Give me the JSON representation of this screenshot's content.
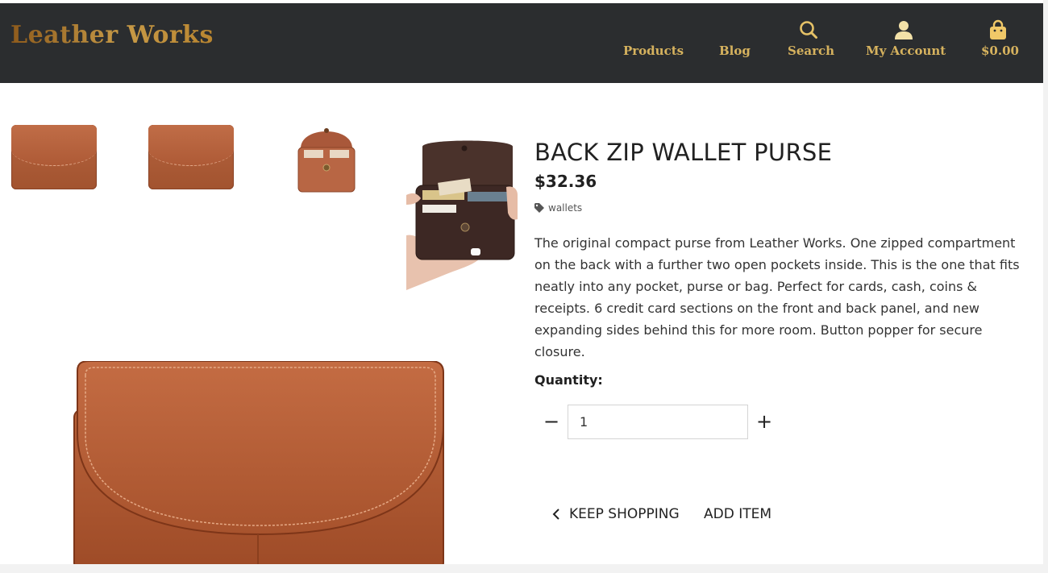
{
  "header": {
    "logo": "Leather Works",
    "nav": {
      "products": "Products",
      "blog": "Blog",
      "search": "Search",
      "account": "My Account",
      "cart": "$0.00"
    },
    "colors": {
      "background": "#2b2d2f",
      "accent": "#d6b25e"
    }
  },
  "product": {
    "title": "BACK ZIP WALLET PURSE",
    "price": "$32.36",
    "tag": "wallets",
    "description": "The original compact purse from Leather Works. One zipped compartment on the back with a further two open pockets inside. This is the one that fits neatly into any pocket, purse or bag. Perfect for cards, cash, coins & receipts. 6 credit card sections on the front and back panel, and new expanding sides behind this for more room. Button popper for secure closure.",
    "quantity_label": "Quantity:",
    "quantity_value": "1"
  },
  "icons": {
    "tag": "tag-icon",
    "search": "search-icon",
    "account": "user-icon",
    "cart": "shopping-bag-icon",
    "back": "chevron-left-icon"
  },
  "actions": {
    "decrement": "−",
    "increment": "+",
    "keep_shopping": "KEEP SHOPPING",
    "add_item": "ADD ITEM"
  }
}
